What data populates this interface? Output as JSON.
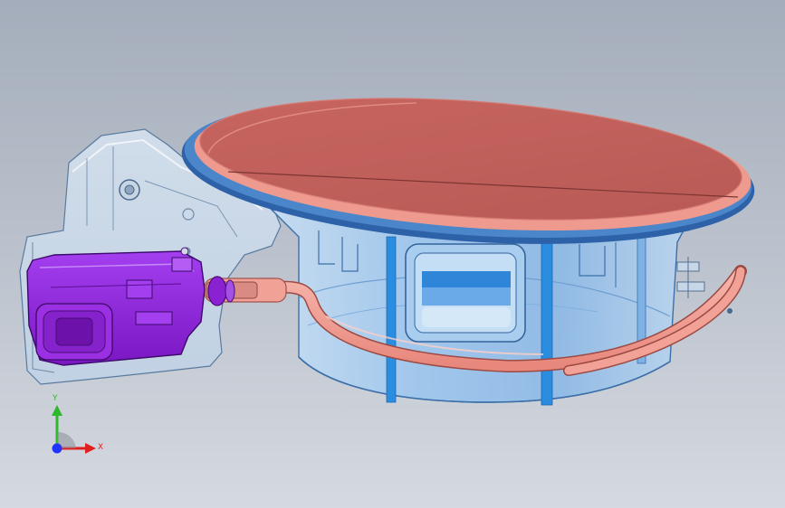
{
  "viewport": {
    "background_top": "#a4adbb",
    "background_bottom": "#d5d9e0"
  },
  "model": {
    "parts": [
      "fuel-door-housing",
      "fuel-door-flap",
      "flap-seal-ring",
      "mounting-bracket",
      "latch-actuator",
      "actuator-plunger",
      "drain-hose"
    ],
    "colors": {
      "housing": "#9ec6ee",
      "housing_edge": "#3c6fa8",
      "flap": "#cd6b66",
      "flap_edge": "#ef9a8f",
      "seal_ring": "#2e62a8",
      "bracket": "#c4d7ea",
      "actuator": "#8a22d4",
      "hose": "#f3a095"
    }
  },
  "triad": {
    "x_label": "X",
    "y_label": "Y",
    "x_color": "#e02020",
    "y_color": "#2eb82e",
    "z_color": "#2233ff"
  }
}
